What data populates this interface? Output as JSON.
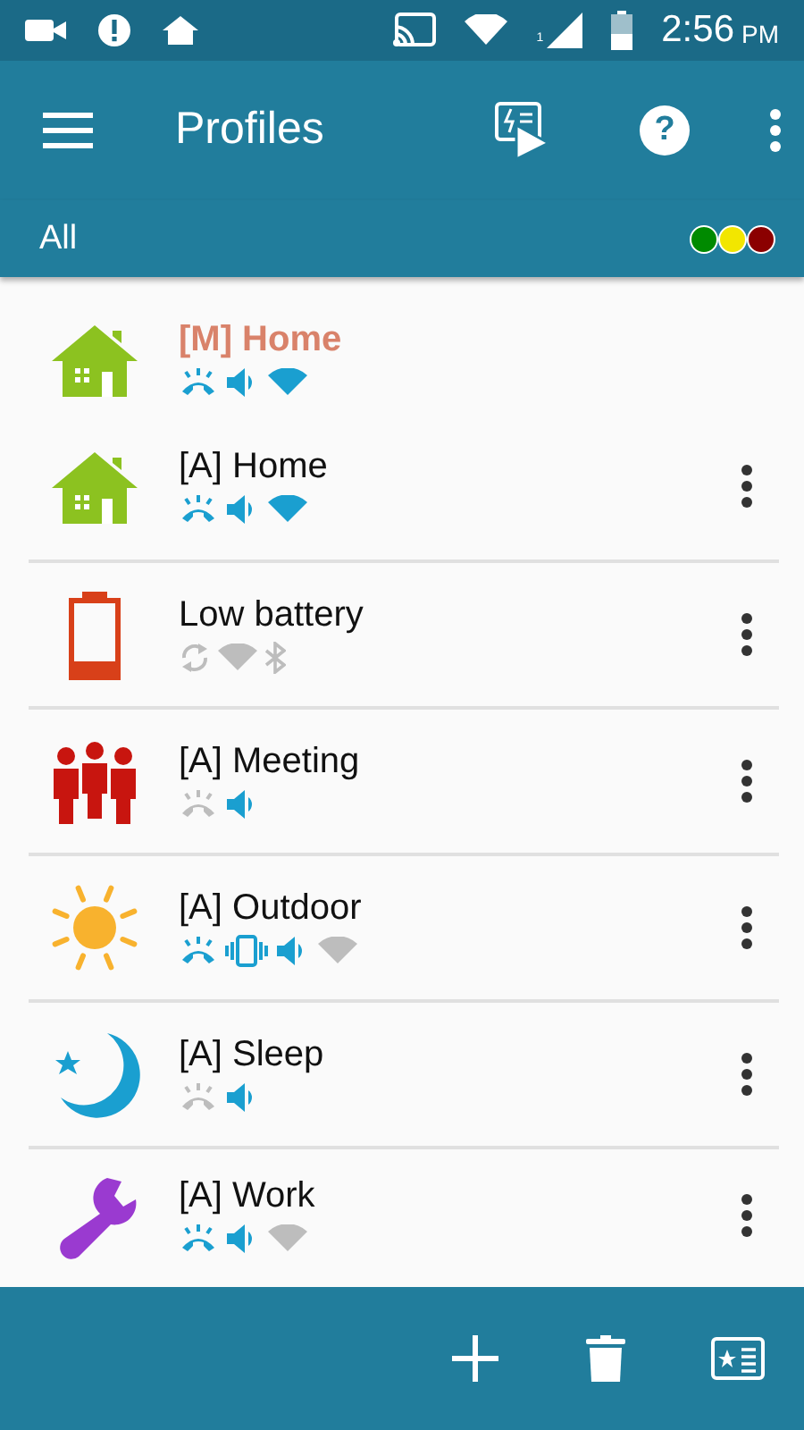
{
  "status_bar": {
    "sim_label": "1",
    "time": "2:56",
    "meridiem": "PM"
  },
  "app_bar": {
    "title": "Profiles",
    "help_label": "?"
  },
  "filter": {
    "label": "All",
    "dots": [
      {
        "color": "#008a00"
      },
      {
        "color": "#f2e600"
      },
      {
        "color": "#8b0000"
      }
    ]
  },
  "activated_profile": {
    "name": "[M] Home",
    "kind": "home",
    "indicators": [
      {
        "kind": "ringer",
        "on": true
      },
      {
        "kind": "volume",
        "on": true
      },
      {
        "kind": "wifi",
        "on": true
      }
    ]
  },
  "profiles": [
    {
      "name": "[A] Home",
      "kind": "home",
      "indicators": [
        {
          "kind": "ringer",
          "on": true
        },
        {
          "kind": "volume",
          "on": true
        },
        {
          "kind": "wifi",
          "on": true
        }
      ]
    },
    {
      "name": "Low battery",
      "kind": "battery",
      "indicators": [
        {
          "kind": "sync",
          "on": false
        },
        {
          "kind": "wifi",
          "on": false
        },
        {
          "kind": "bluetooth",
          "on": false
        }
      ]
    },
    {
      "name": "[A] Meeting",
      "kind": "people",
      "indicators": [
        {
          "kind": "ringer",
          "on": false
        },
        {
          "kind": "volume",
          "on": true
        }
      ]
    },
    {
      "name": "[A] Outdoor",
      "kind": "sun",
      "indicators": [
        {
          "kind": "ringer",
          "on": true
        },
        {
          "kind": "vibrate",
          "on": true
        },
        {
          "kind": "volume",
          "on": true
        },
        {
          "kind": "wifi",
          "on": false
        }
      ]
    },
    {
      "name": "[A] Sleep",
      "kind": "moon",
      "indicators": [
        {
          "kind": "ringer",
          "on": false
        },
        {
          "kind": "volume",
          "on": true
        }
      ]
    },
    {
      "name": "[A] Work",
      "kind": "wrench",
      "indicators": [
        {
          "kind": "ringer",
          "on": true
        },
        {
          "kind": "volume",
          "on": true
        },
        {
          "kind": "wifi",
          "on": false
        }
      ]
    }
  ]
}
